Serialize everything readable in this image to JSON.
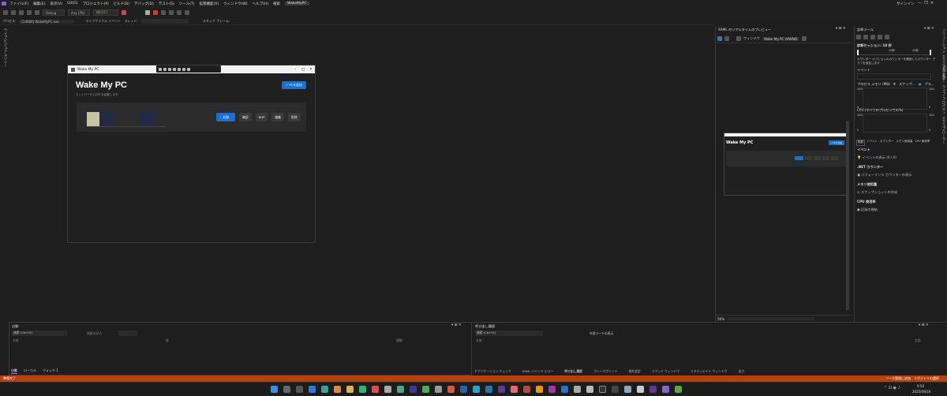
{
  "menu": {
    "items": [
      "ファイル(F)",
      "編集(E)",
      "表示(V)",
      "Git(G)",
      "プロジェクト(P)",
      "ビルド(B)",
      "デバッグ(D)",
      "テスト(S)",
      "ツール(T)",
      "拡張機能(X)",
      "ウィンドウ(W)",
      "ヘルプ(H)"
    ],
    "search": "検索",
    "project": "WakeMyPC",
    "signin": "サインイン"
  },
  "toolbar": {
    "config": "Debug",
    "platform": "Any CPU",
    "continue": "続行(C)"
  },
  "procbar": {
    "process_label": "プロセス:",
    "process": "[14988] WakeMyPC.exe",
    "lifecycle": "ライフサイクル イベント",
    "thread_label": "スレッド:",
    "stackframe_label": "スタック フレーム:"
  },
  "left_vtab": "ライブビジュアルツリー",
  "right_vtabs": [
    "ソリューション エクスプローラー",
    "Git 変更",
    "ライブ プロパティ エクスプローラー"
  ],
  "app": {
    "title": "Wake My PC",
    "heading": "Wake My PC",
    "subtitle": "ネットワーク上のPCを起動します",
    "add_button": "+ PCを追加",
    "buttons": {
      "wake": "起動",
      "check": "確認",
      "rdp": "RDP",
      "edit": "編集",
      "delete": "削除"
    },
    "wake_icon": "lightning-icon"
  },
  "xaml": {
    "title": "XAML のリアルタイムのプレビュー",
    "window_label": "ウィンドウ",
    "window_select": "Wake My PC (HWND:",
    "zoom": "50%",
    "mini_title": "Wake My PC",
    "mini_btn": "+ PCを追加"
  },
  "diag": {
    "title": "診断ツール",
    "session": "診断セッション: 10 秒",
    "tick_10": "10秒",
    "tick_20": "20秒",
    "hint": "カウンター オプションのカウンターを確認してカウンター グラフを追加します",
    "events": "イベント",
    "memory": "プロセス メモリ (MB)",
    "snapshot": "スナップ...",
    "private": "プラ...",
    "cpu": "CPU (すべてのプロセッサの%)",
    "axis_100": "100",
    "axis_0": "0",
    "tabs": [
      "概要",
      "イベント",
      "カウンター",
      "メモリ使用量",
      "CPU 使用率"
    ],
    "sec_events": "イベント",
    "show_events": "イベントの表示 (0 / 0)",
    "sec_net": ".NET カウンター",
    "perf_counters": "パフォーマンス カウンターの表示",
    "sec_mem": "メモリ使用量",
    "take_snapshot": "スナップショットの作成",
    "sec_cpu": "CPU 使用率",
    "record": "記録の開始"
  },
  "locals": {
    "title": "自動",
    "search": "検索 (Ctrl+E)",
    "depth": "検索の深さ:",
    "cols": [
      "名前",
      "値",
      "種類"
    ],
    "tabs": [
      "自動",
      "ローカル",
      "ウォッチ 1"
    ]
  },
  "callstack": {
    "title": "呼び出し履歴",
    "search": "検索 (Ctrl+E)",
    "external": "外部コードの表示",
    "cols": [
      "名前",
      "言語"
    ],
    "tabs": [
      "アプリケーション チェック",
      "XAML バインド エラー",
      "呼び出し履歴",
      "ブレークポイント",
      "例外設定",
      "コマンド ウィンドウ",
      "イミディエイト ウィンドウ",
      "出力"
    ]
  },
  "status": {
    "left": "準備完了",
    "right": "ソース管理に追加",
    "repo": "リポジトリの選択"
  },
  "clock": {
    "time": "9:50",
    "date": "2025/09/19"
  }
}
